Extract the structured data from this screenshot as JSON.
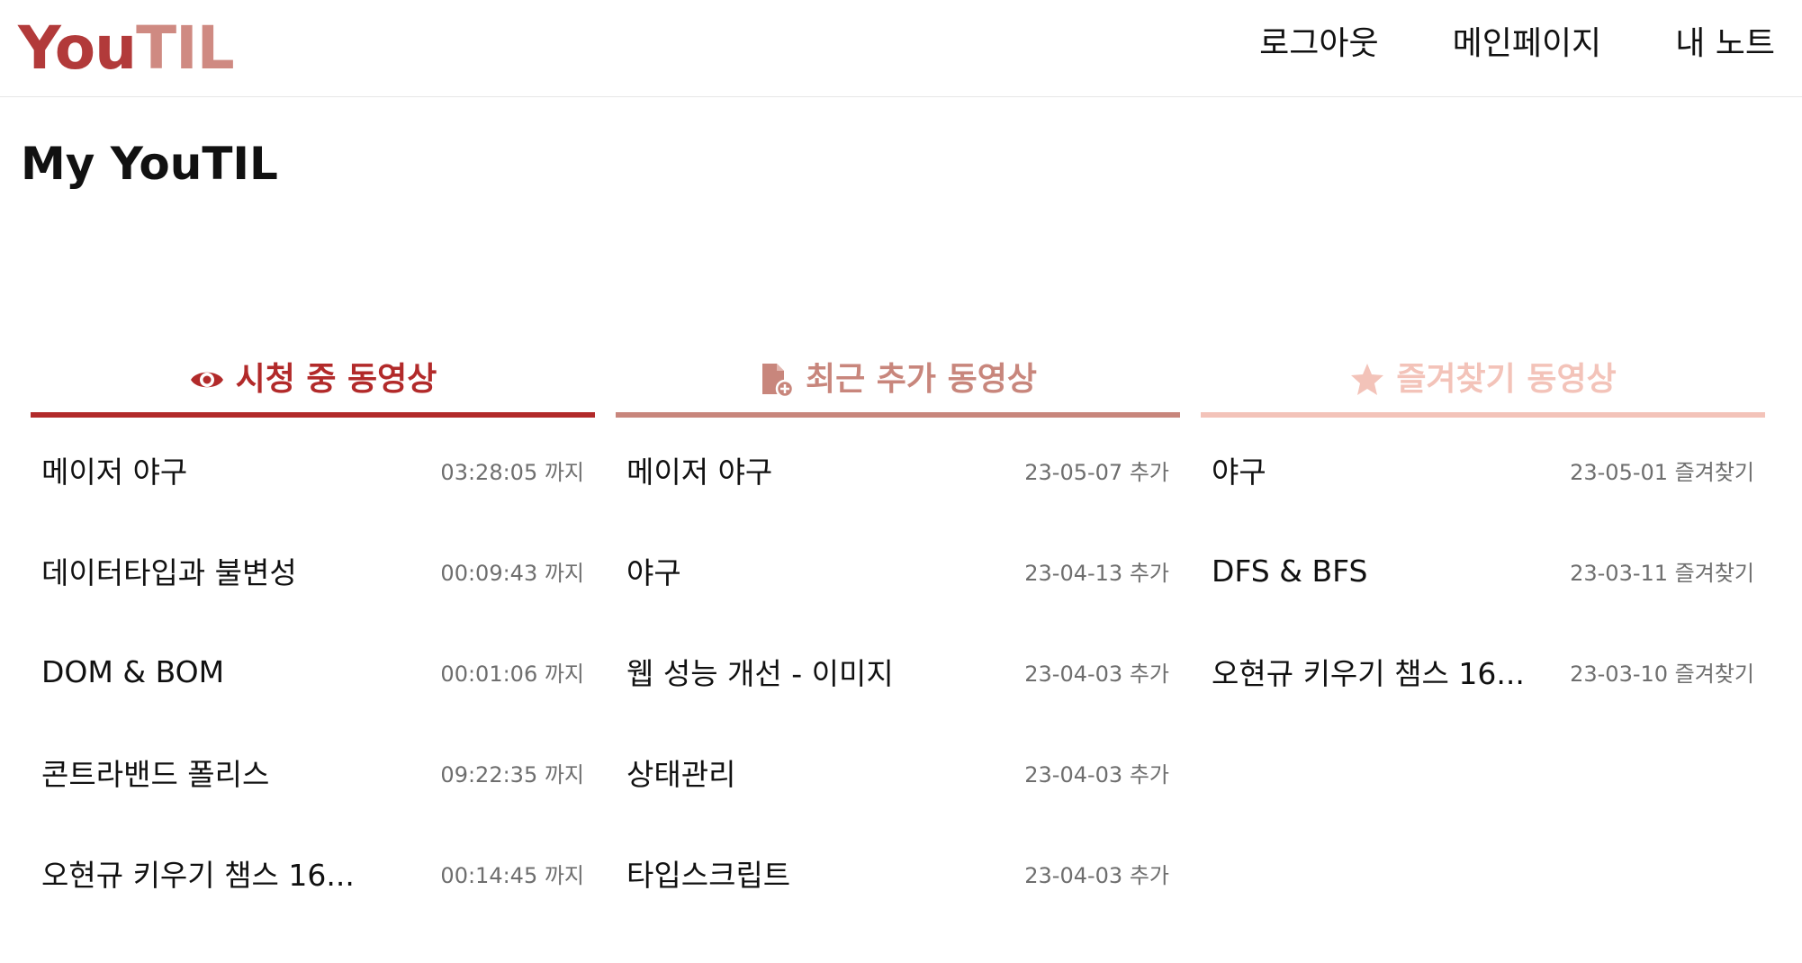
{
  "header": {
    "logo_you": "You",
    "logo_til": "TIL",
    "nav": [
      "로그아웃",
      "메인페이지",
      "내 노트"
    ]
  },
  "page_title": "My YouTIL",
  "panels": [
    {
      "title": "시청 중 동영상",
      "icon": "eye-icon",
      "color": "#b22a2a",
      "items": [
        {
          "title": "메이저 야구",
          "meta": "03:28:05 까지"
        },
        {
          "title": "데이터타입과 불변성",
          "meta": "00:09:43 까지"
        },
        {
          "title": "DOM & BOM",
          "meta": "00:01:06 까지"
        },
        {
          "title": "콘트라밴드 폴리스",
          "meta": "09:22:35 까지"
        },
        {
          "title": "오현규 키우기 챔스 16...",
          "meta": "00:14:45 까지"
        }
      ]
    },
    {
      "title": "최근 추가 동영상",
      "icon": "file-add-icon",
      "color": "#c8867c",
      "items": [
        {
          "title": "메이저 야구",
          "meta": "23-05-07 추가"
        },
        {
          "title": "야구",
          "meta": "23-04-13 추가"
        },
        {
          "title": "웹 성능 개선 - 이미지",
          "meta": "23-04-03 추가"
        },
        {
          "title": "상태관리",
          "meta": "23-04-03 추가"
        },
        {
          "title": "타입스크립트",
          "meta": "23-04-03 추가"
        }
      ]
    },
    {
      "title": "즐겨찾기 동영상",
      "icon": "star-icon",
      "color": "#f3c3b9",
      "items": [
        {
          "title": "야구",
          "meta": "23-05-01 즐겨찾기"
        },
        {
          "title": "DFS & BFS",
          "meta": "23-03-11 즐겨찾기"
        },
        {
          "title": "오현규 키우기 챔스 16...",
          "meta": "23-03-10 즐겨찾기"
        }
      ]
    }
  ]
}
